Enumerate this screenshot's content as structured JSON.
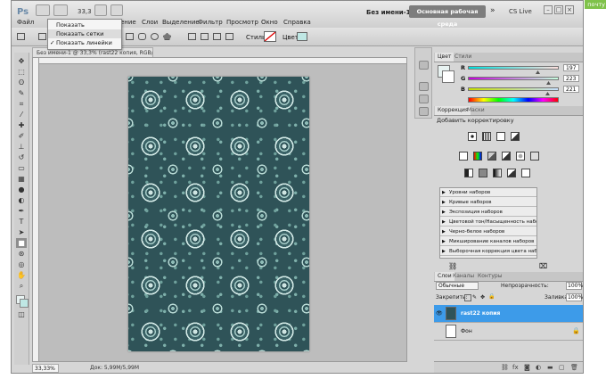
{
  "menubar": {
    "logo": "Ps",
    "menus": [
      "Файл",
      "ение",
      "Слои",
      "Выделение",
      "Фильтр",
      "Просмотр",
      "Окно",
      "Справка"
    ],
    "zoom": "33,3",
    "doc_name": "Без имени-1",
    "workspace": "Основная рабочая среда",
    "expand": "»",
    "cslive": "CS Live",
    "mail": "почту"
  },
  "dropdown": {
    "items": [
      "Показать направляющие",
      "Показать сетки",
      "Показать линейки"
    ],
    "checked_index": 2,
    "check_mark": "✓"
  },
  "options": {
    "style_label": "Стиль:",
    "color_label": "Цвет:",
    "color_hex": "#bfe7e4"
  },
  "document": {
    "tab": "Без имени-1 @ 33,3% (rast22 копия, RGB/8) *",
    "status_zoom": "33,33%",
    "status_doc": "Док: 5,99M/5,99M"
  },
  "color_panel": {
    "tabs": [
      "Цвет",
      "Стили"
    ],
    "r_label": "R",
    "r_value": "197",
    "g_label": "G",
    "g_value": "223",
    "b_label": "B",
    "b_value": "221"
  },
  "adjust_panel": {
    "tabs": [
      "Коррекция",
      "Маски"
    ],
    "title": "Добавить корректировку",
    "presets": [
      "Уровни наборов",
      "Кривые наборов",
      "Экспозиция наборов",
      "Цветовой тон/Насыщенность наборов",
      "Черно-белое наборов",
      "Микширование каналов наборов",
      "Выборочная коррекция цвета наборов"
    ]
  },
  "layers_panel": {
    "tabs": [
      "Слои",
      "Каналы",
      "Контуры"
    ],
    "blend_mode": "Обычные",
    "opacity_label": "Непрозрачность:",
    "opacity_value": "100%",
    "lock_label": "Закрепить:",
    "fill_label": "Заливка:",
    "fill_value": "100%",
    "layers": [
      {
        "name": "rast22 копия",
        "selected": true
      },
      {
        "name": "Фон",
        "selected": false
      }
    ]
  }
}
